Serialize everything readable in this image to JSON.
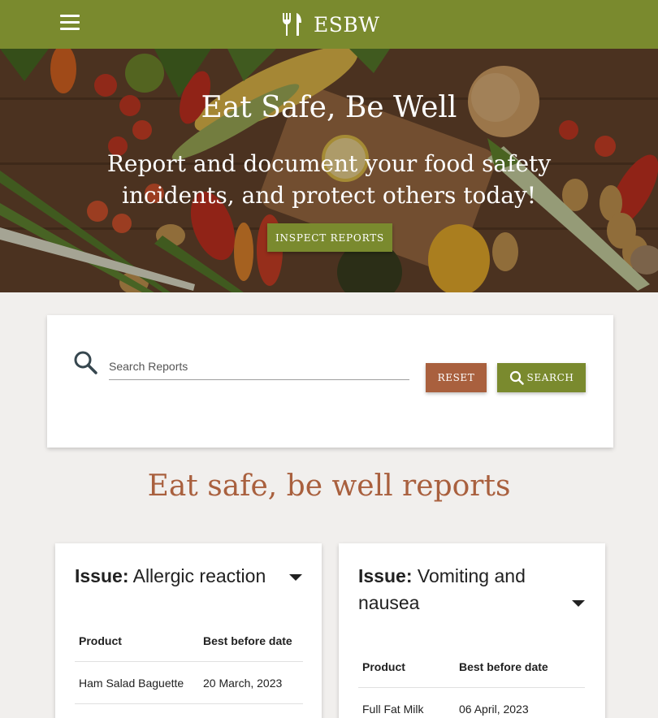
{
  "navbar": {
    "brand": "ESBW",
    "bg_color": "#7a8a2e"
  },
  "hero": {
    "title": "Eat Safe, Be Well",
    "subtitle": "Report and document your food safety incidents, and protect others today!",
    "cta_label": "INSPECT REPORTS"
  },
  "search": {
    "placeholder": "Search Reports",
    "value": "",
    "reset_label": "RESET",
    "search_label": "SEARCH"
  },
  "section": {
    "title": "Eat safe, be well reports"
  },
  "reports": [
    {
      "issue_label": "Issue:",
      "issue": "Allergic reaction",
      "columns": [
        "Product",
        "Best before date"
      ],
      "rows": [
        {
          "product": "Ham Salad Baguette",
          "date": "20 March, 2023"
        }
      ]
    },
    {
      "issue_label": "Issue:",
      "issue": "Vomiting and nausea",
      "columns": [
        "Product",
        "Best before date"
      ],
      "rows": [
        {
          "product": "Full Fat Milk",
          "date": "06 April, 2023"
        }
      ]
    }
  ],
  "colors": {
    "primary": "#7a8a2e",
    "accent": "#a9603e",
    "background": "#f1efed"
  },
  "icons": {
    "menu": "hamburger-icon",
    "brand": "fork-knife-icon",
    "search": "magnifier-icon",
    "expand": "caret-down-icon"
  }
}
